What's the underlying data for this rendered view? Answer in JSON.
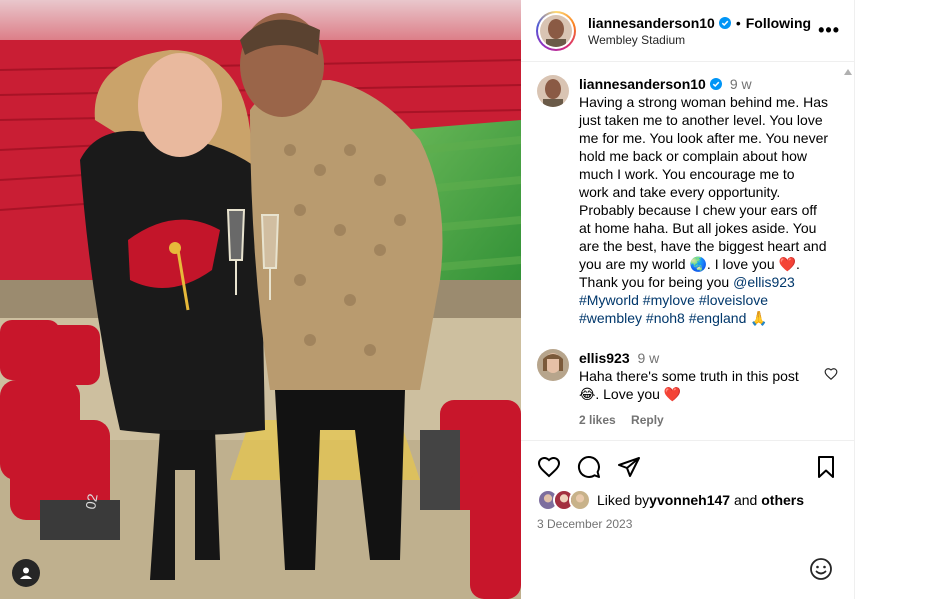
{
  "post": {
    "author": "liannesanderson10",
    "follow_status": "Following",
    "separator": "•",
    "location": "Wembley Stadium",
    "more_menu": "•••"
  },
  "caption": {
    "username": "liannesanderson10",
    "time": "9 w",
    "lines": [
      "Having a strong woman behind me. Has",
      "just taken me to another level. You love",
      "me for me. You look after me. You never",
      "hold me back or complain about how",
      "much I work. You encourage me to",
      "work and take every opportunity.",
      "Probably because I chew your ears off",
      "at home haha. But all jokes aside. You",
      "are the best, have the biggest heart and"
    ],
    "line10_a": "you are my world ",
    "line10_b": ". I love you ",
    "line10_c": ".",
    "line11_a": "Thank you for being you ",
    "mention": "@ellis923",
    "hashtags_1": "#Myworld #mylove #loveislove",
    "hashtags_2": "#wembley #noh8 #england",
    "emojis": {
      "globe": "🌏",
      "heart": "❤️",
      "pray": "🙏"
    }
  },
  "comment": {
    "username": "ellis923",
    "time": "9 w",
    "text_a": "Haha there's some truth in this post",
    "text_b": ". Love you ",
    "emoji_laugh": "😂",
    "emoji_heart": "❤️",
    "likes": "2 likes",
    "reply": "Reply"
  },
  "footer": {
    "liked_by_prefix": "Liked by ",
    "liked_by_user": "yvonneh147",
    "liked_by_and": " and ",
    "liked_by_others": "others",
    "date": "3 December 2023"
  },
  "photo": {
    "seat_label": "02"
  },
  "colors": {
    "verified": "#0095f6",
    "link": "#00376b",
    "muted": "#737373",
    "stadium_red": "#c4182c",
    "pitch_green": "#3a9a3c"
  },
  "icons": [
    "verified-badge-icon",
    "more-options-icon",
    "heart-icon",
    "comment-icon",
    "share-icon",
    "save-icon",
    "emoji-icon",
    "user-tag-icon"
  ]
}
